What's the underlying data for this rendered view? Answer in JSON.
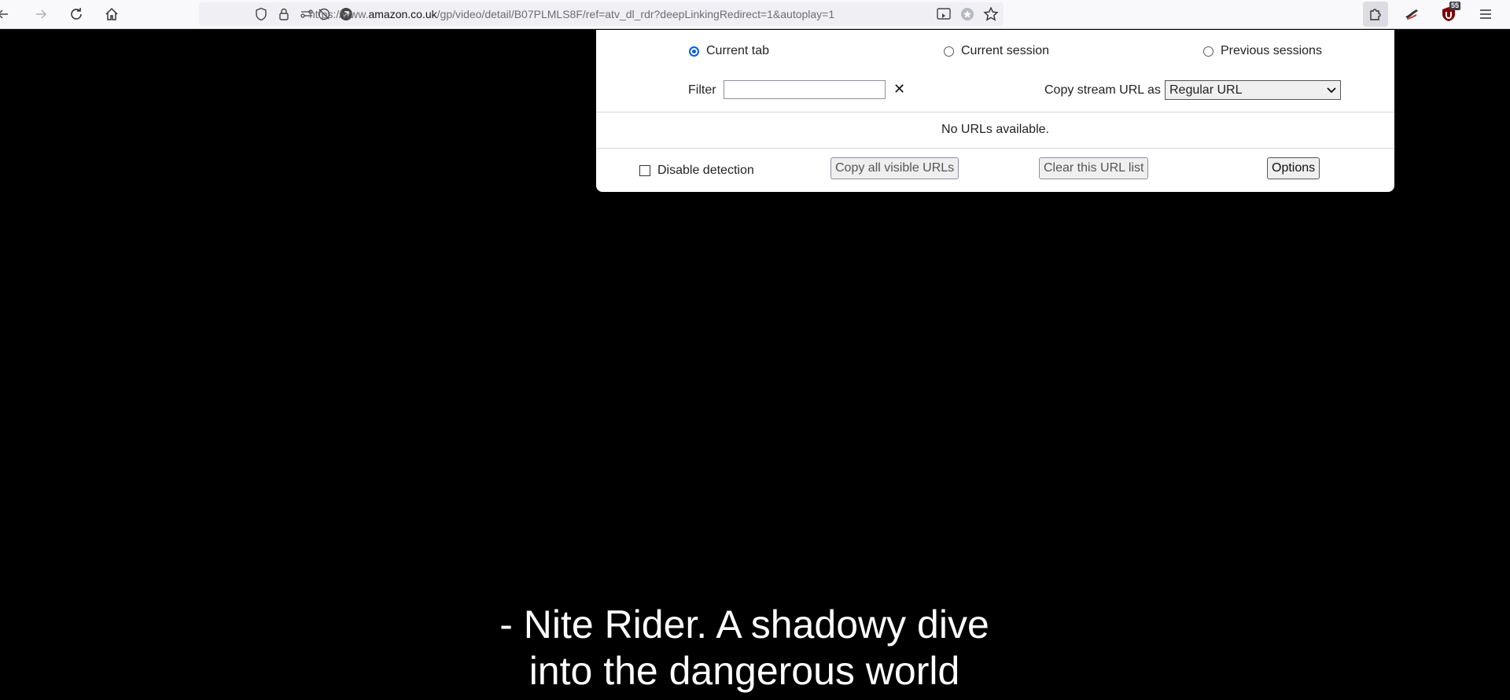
{
  "browser": {
    "url_prefix": "https://www.",
    "url_host": "amazon.co.uk",
    "url_path": "/gp/video/detail/B07PLMLS8F/ref=atv_dl_rdr?deepLinkingRedirect=1&autoplay=1",
    "extension_badge": "55"
  },
  "popup": {
    "tabs": [
      {
        "label": "Current tab",
        "selected": true
      },
      {
        "label": "Current session",
        "selected": false
      },
      {
        "label": "Previous sessions",
        "selected": false
      }
    ],
    "filter_label": "Filter",
    "filter_value": "",
    "filter_clear": "✕",
    "copy_label": "Copy stream URL as",
    "copy_select_value": "Regular URL",
    "empty_message": "No URLs available.",
    "disable_detection_label": "Disable detection",
    "copy_all_button": "Copy all visible URLs",
    "clear_list_button": "Clear this URL list",
    "options_button": "Options"
  },
  "subtitles": {
    "line1": "- Nite Rider. A shadowy dive",
    "line2": "into the dangerous world"
  },
  "colors": {
    "accent": "#0060df",
    "toolbar_bg": "#f9f9fb",
    "urlbar_bg": "#f0f0f4"
  }
}
